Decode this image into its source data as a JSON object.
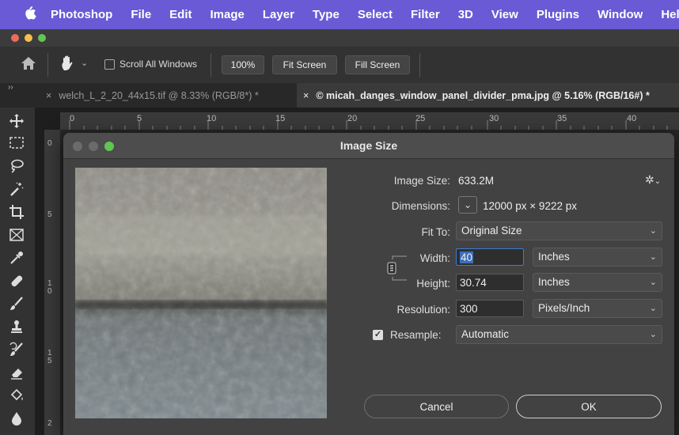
{
  "menubar": {
    "app": "Photoshop",
    "items": [
      "File",
      "Edit",
      "Image",
      "Layer",
      "Type",
      "Select",
      "Filter",
      "3D",
      "View",
      "Plugins",
      "Window",
      "Hel"
    ]
  },
  "options_bar": {
    "scroll_all_windows": "Scroll All Windows",
    "zoom_100": "100%",
    "fit_screen": "Fit Screen",
    "fill_screen": "Fill Screen"
  },
  "tabs": [
    {
      "label": "welch_L_2_20_44x15.tif @ 8.33% (RGB/8*) *",
      "active": false
    },
    {
      "label": "© micah_danges_window_panel_divider_pma.jpg @ 5.16% (RGB/16#) *",
      "active": true
    }
  ],
  "ruler": {
    "top_ticks": [
      "0",
      "5",
      "10",
      "15",
      "20",
      "25",
      "30",
      "35",
      "40"
    ],
    "left_ticks": [
      "0",
      "5",
      "1\n0",
      "1\n5",
      "2"
    ]
  },
  "dialog": {
    "title": "Image Size",
    "image_size_label": "Image Size:",
    "image_size_value": "633.2M",
    "dimensions_label": "Dimensions:",
    "dimensions_value": "12000 px  ×  9222 px",
    "fit_to_label": "Fit To:",
    "fit_to_value": "Original Size",
    "width_label": "Width:",
    "width_value": "40",
    "width_unit": "Inches",
    "height_label": "Height:",
    "height_value": "30.74",
    "height_unit": "Inches",
    "resolution_label": "Resolution:",
    "resolution_value": "300",
    "resolution_unit": "Pixels/Inch",
    "resample_label": "Resample:",
    "resample_checked": true,
    "resample_value": "Automatic",
    "cancel": "Cancel",
    "ok": "OK"
  },
  "colors": {
    "menubar": "#6a5ad6",
    "close": "#ed6a5e",
    "minimize": "#f4bf4f",
    "zoom": "#61c554",
    "field_focus": "#3d7bd6"
  }
}
